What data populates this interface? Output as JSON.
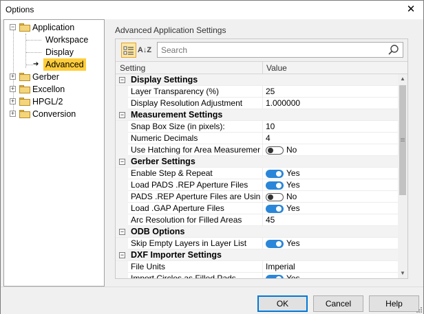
{
  "window": {
    "title": "Options",
    "close_glyph": "✕"
  },
  "tree": {
    "items": [
      {
        "label": "Application",
        "expander": "−",
        "has_folder": true
      },
      {
        "label": "Workspace"
      },
      {
        "label": "Display"
      },
      {
        "label": "Advanced",
        "selected": true
      },
      {
        "label": "Gerber",
        "expander": "+",
        "has_folder": true
      },
      {
        "label": "Excellon",
        "expander": "+",
        "has_folder": true
      },
      {
        "label": "HPGL/2",
        "expander": "+",
        "has_folder": true
      },
      {
        "label": "Conversion",
        "expander": "+",
        "has_folder": true
      }
    ],
    "selected_arrow_icon": "arrow-right-icon",
    "accent": "#ffcd3a"
  },
  "panel": {
    "title": "Advanced Application Settings"
  },
  "toolbar": {
    "categorized_icon": "categorized-icon",
    "alphabetical_icon": "sort-az-icon",
    "sort_glyph": "A↓Z",
    "search_placeholder": "Search",
    "search_icon": "search-icon"
  },
  "grid": {
    "headers": {
      "setting": "Setting",
      "value": "Value"
    },
    "collapse_glyph": "−",
    "rows": [
      {
        "type": "category",
        "label": "Display Settings"
      },
      {
        "type": "prop",
        "name": "Layer Transparency (%)",
        "value": "25"
      },
      {
        "type": "prop",
        "name": "Display Resolution Adjustment",
        "value": "1.000000"
      },
      {
        "type": "category",
        "label": "Measurement Settings"
      },
      {
        "type": "prop",
        "name": "Snap Box Size (in pixels):",
        "value": "10"
      },
      {
        "type": "prop",
        "name": "Numeric Decimals",
        "value": "4"
      },
      {
        "type": "toggle",
        "name": "Use Hatching for Area Measurement",
        "on": false,
        "value": "No"
      },
      {
        "type": "category",
        "label": "Gerber Settings"
      },
      {
        "type": "toggle",
        "name": "Enable Step & Repeat",
        "on": true,
        "value": "Yes"
      },
      {
        "type": "toggle",
        "name": "Load PADS .REP Aperture Files",
        "on": true,
        "value": "Yes"
      },
      {
        "type": "toggle",
        "name": "PADS .REP Aperture Files are Using ...",
        "on": false,
        "value": "No"
      },
      {
        "type": "toggle",
        "name": "Load .GAP Aperture Files",
        "on": true,
        "value": "Yes"
      },
      {
        "type": "prop",
        "name": "Arc Resolution for Filled Areas",
        "value": "45"
      },
      {
        "type": "category",
        "label": "ODB Options"
      },
      {
        "type": "toggle",
        "name": "Skip Empty Layers in Layer List",
        "on": true,
        "value": "Yes"
      },
      {
        "type": "category",
        "label": "DXF Importer Settings"
      },
      {
        "type": "prop",
        "name": "File Units",
        "value": "Imperial"
      },
      {
        "type": "toggle",
        "name": "Import Circles as Filled Pads",
        "on": true,
        "value": "Yes"
      }
    ],
    "toggle_on_color": "#2a86d8"
  },
  "scrollbar": {
    "up_glyph": "▲",
    "down_glyph": "▼"
  },
  "buttons": {
    "ok": "OK",
    "cancel": "Cancel",
    "help": "Help"
  }
}
